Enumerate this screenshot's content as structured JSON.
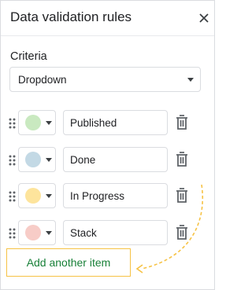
{
  "panel": {
    "title": "Data validation rules",
    "close_icon": "close-icon"
  },
  "criteria": {
    "label": "Criteria",
    "selected": "Dropdown"
  },
  "items": [
    {
      "value": "Published",
      "color": "#c9e9c0"
    },
    {
      "value": "Done",
      "color": "#c3d9e5"
    },
    {
      "value": "In Progress",
      "color": "#fde49c"
    },
    {
      "value": "Stack",
      "color": "#f7ccc7"
    }
  ],
  "add_item": {
    "label": "Add another item"
  },
  "colors": {
    "accent_green": "#188038",
    "highlight_yellow": "#f6c244"
  }
}
